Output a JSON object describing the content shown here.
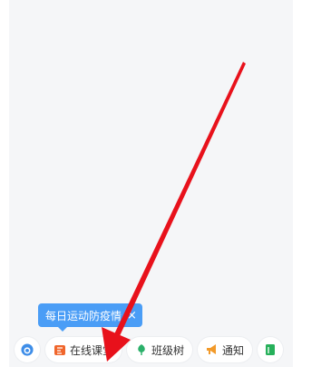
{
  "tooltip": {
    "text": "每日运动防疫情",
    "close_glyph": "×"
  },
  "toolbar": {
    "items": [
      {
        "label": "",
        "icon": "avatar-icon"
      },
      {
        "label": "在线课堂",
        "icon": "online-class-icon"
      },
      {
        "label": "班级树",
        "icon": "class-tree-icon"
      },
      {
        "label": "通知",
        "icon": "megaphone-icon"
      },
      {
        "label": "",
        "icon": "green-book-icon"
      }
    ]
  },
  "colors": {
    "tooltip": "#4a9df6",
    "arrow": "#e8111b",
    "online_class": "#f0662c",
    "class_tree": "#2bb06a",
    "notice": "#f29a2a",
    "book": "#26b05a"
  }
}
